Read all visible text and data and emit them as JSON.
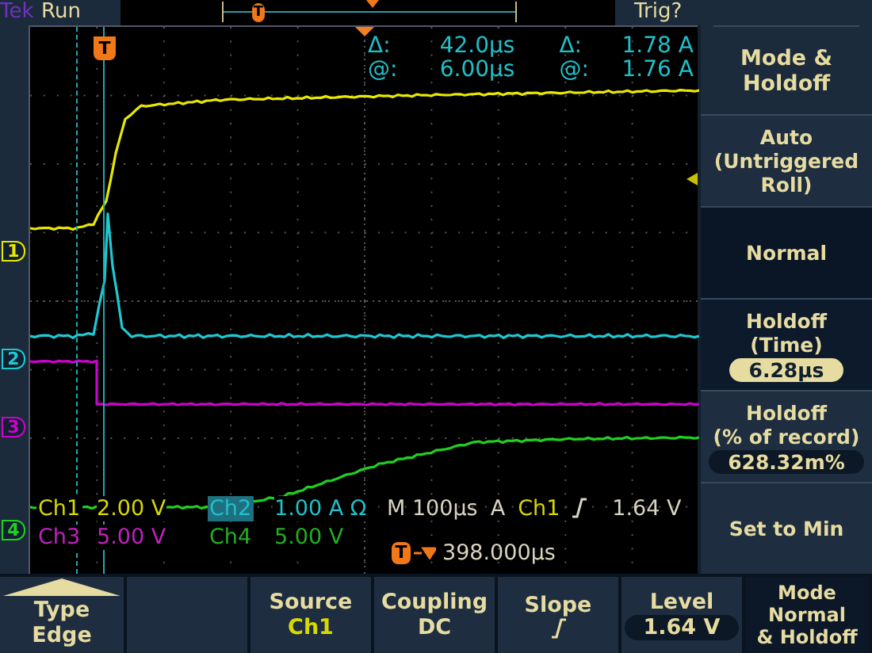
{
  "top_bar": {
    "brand": "Tek",
    "status": "Run",
    "record_marker": "T",
    "trigger_status": "Trig?"
  },
  "display": {
    "trigger_marker": "T",
    "channel_markers": [
      {
        "label": "1",
        "color": "#e8e800"
      },
      {
        "label": "2",
        "color": "#20c8d0"
      },
      {
        "label": "3",
        "color": "#d000d0"
      },
      {
        "label": "4",
        "color": "#20d020"
      }
    ],
    "cursor_readout": [
      {
        "symbol": "Δ:",
        "time": "42.0µs",
        "symbol_2": "Δ:",
        "amplitude": "1.78 A"
      },
      {
        "symbol": "@:",
        "time": "6.00µs",
        "symbol_2": "@:",
        "amplitude": "1.76 A"
      }
    ],
    "channel_readouts": [
      {
        "name": "Ch1",
        "scale": "2.00 V",
        "color": "#d8d800",
        "selected": false
      },
      {
        "name": "Ch2",
        "scale": "1.00 A",
        "suffix": "Ω",
        "color": "#20c0c8",
        "selected": true
      },
      {
        "name": "Ch3",
        "scale": "5.00 V",
        "color": "#c020c0",
        "selected": false
      },
      {
        "name": "Ch4",
        "scale": "5.00 V",
        "color": "#20b020",
        "selected": false
      }
    ],
    "timebase": {
      "scale": "M 100µs",
      "trigger_label": "A",
      "trigger_source": "Ch1",
      "trigger_level": "1.64 V"
    },
    "trigger_position": {
      "marker": "T",
      "delay": "398.000µs"
    }
  },
  "side_menu": {
    "title": [
      "Mode &",
      "Holdoff"
    ],
    "items": [
      {
        "kind": "option",
        "lines": [
          "Auto",
          "(Untriggered",
          "Roll)"
        ],
        "selected": false
      },
      {
        "kind": "option",
        "lines": [
          "Normal"
        ],
        "selected": true
      },
      {
        "kind": "value",
        "lines": [
          "Holdoff",
          "(Time)"
        ],
        "value": "6.28µs",
        "selected": true
      },
      {
        "kind": "value",
        "lines": [
          "Holdoff",
          "(% of record)"
        ],
        "value": "628.32m%",
        "selected": false
      },
      {
        "kind": "action",
        "lines": [
          "Set to Min"
        ]
      }
    ]
  },
  "bottom_menu": [
    {
      "kind": "type",
      "label": "Type",
      "value": "Edge"
    },
    {
      "kind": "blank"
    },
    {
      "kind": "source",
      "label": "Source",
      "value": "Ch1"
    },
    {
      "kind": "plain",
      "label": "Coupling",
      "value": "DC"
    },
    {
      "kind": "slope",
      "label": "Slope"
    },
    {
      "kind": "pill",
      "label": "Level",
      "value": "1.64 V"
    },
    {
      "kind": "title",
      "lines": [
        "Mode",
        "Normal",
        "& Holdoff"
      ]
    }
  ]
}
